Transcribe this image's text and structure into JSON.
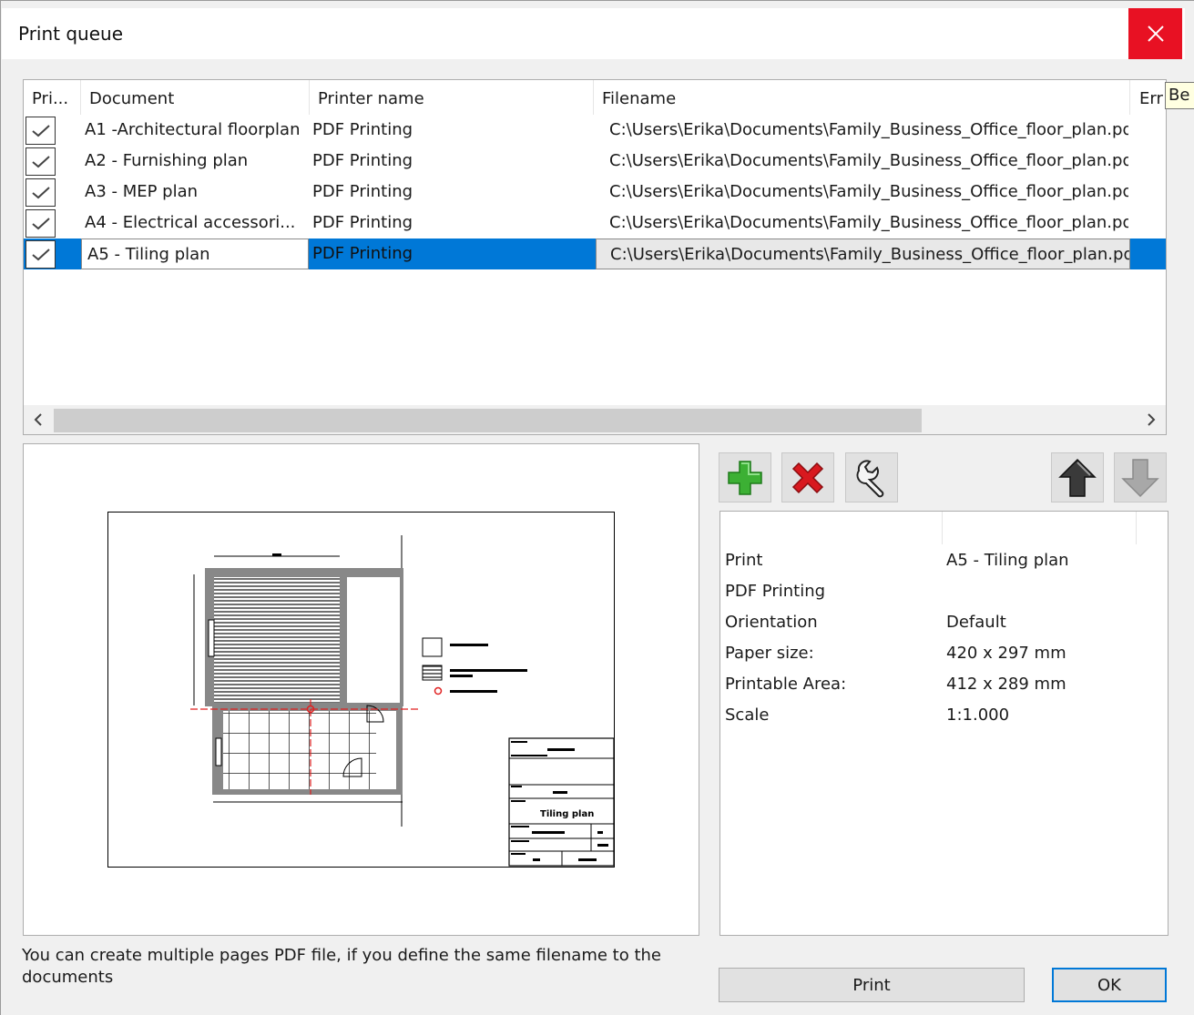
{
  "window": {
    "title": "Print queue"
  },
  "tooltip": {
    "text": "Be"
  },
  "list": {
    "columns": [
      "Pri...",
      "Document",
      "Printer name",
      "Filename",
      "Err"
    ],
    "rows": [
      {
        "checked": true,
        "document": "A1 -Architectural floorplan",
        "printer": "PDF Printing",
        "filename": "C:\\Users\\Erika\\Documents\\Family_Business_Office_floor_plan.pdf"
      },
      {
        "checked": true,
        "document": "A2 - Furnishing plan",
        "printer": "PDF Printing",
        "filename": "C:\\Users\\Erika\\Documents\\Family_Business_Office_floor_plan.pdf"
      },
      {
        "checked": true,
        "document": "A3 - MEP plan",
        "printer": "PDF Printing",
        "filename": "C:\\Users\\Erika\\Documents\\Family_Business_Office_floor_plan.pdf"
      },
      {
        "checked": true,
        "document": "A4 - Electrical accessori...",
        "printer": "PDF Printing",
        "filename": "C:\\Users\\Erika\\Documents\\Family_Business_Office_floor_plan.pdf"
      },
      {
        "checked": true,
        "document": "A5 - Tiling plan",
        "printer": "PDF Printing",
        "filename": "C:\\Users\\Erika\\Documents\\Family_Business_Office_floor_plan.pdf",
        "selected": true
      }
    ]
  },
  "preview": {
    "sheet_title": "Tiling plan"
  },
  "toolbar": {
    "add": "plus-icon",
    "remove": "x-icon",
    "settings": "wrench-icon",
    "up": "arrow-up-icon",
    "down": "arrow-down-icon"
  },
  "properties": [
    {
      "label": "Print",
      "value": "A5 - Tiling plan"
    },
    {
      "label": "PDF Printing",
      "value": ""
    },
    {
      "label": "Orientation",
      "value": "Default"
    },
    {
      "label": "Paper size:",
      "value": "420 x 297 mm"
    },
    {
      "label": "Printable Area:",
      "value": "412 x 289 mm"
    },
    {
      "label": "Scale",
      "value": "1:1.000"
    }
  ],
  "info": "You can create multiple pages PDF file, if you define the same filename to the documents",
  "buttons": {
    "print": "Print",
    "ok": "OK"
  },
  "colors": {
    "selection": "#0078d7",
    "close": "#e81123",
    "add_green": "#3cb034",
    "remove_red": "#d8191f"
  }
}
